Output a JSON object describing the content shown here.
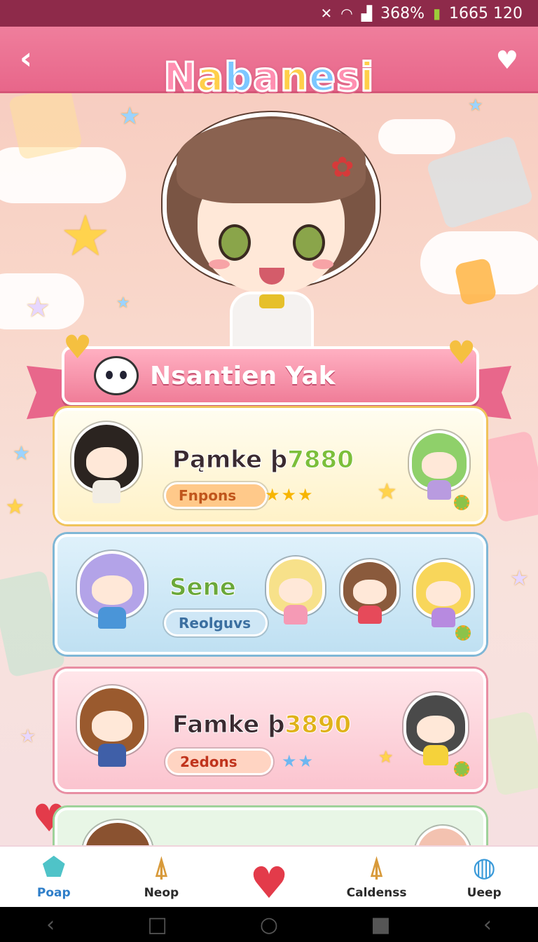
{
  "status_bar": {
    "battery_percent": "368%",
    "time": "1665 120"
  },
  "header": {
    "title": "Nabanesi",
    "back_icon": "chevron-left-icon",
    "favorite_icon": "heart-icon"
  },
  "banner": {
    "title": "Nsantien Yak"
  },
  "cards": [
    {
      "title_prefix": "Pąmke þ",
      "title_number": "7880",
      "pill": "Fnpons",
      "stars": "★★★"
    },
    {
      "title": "Sene",
      "pill": "Reolguvs"
    },
    {
      "title_prefix": "Famke þ",
      "title_number": "3890",
      "pill": "2edons",
      "stars": "★★"
    }
  ],
  "bottom_nav": [
    {
      "label": "Poap",
      "icon": "house-icon",
      "active": true
    },
    {
      "label": "Neop",
      "icon": "cone-icon",
      "active": false
    },
    {
      "label": "",
      "icon": "heart-icon",
      "active": false
    },
    {
      "label": "Caldenss",
      "icon": "cone-icon",
      "active": false
    },
    {
      "label": "Ueep",
      "icon": "globe-icon",
      "active": false
    }
  ],
  "colors": {
    "header_pink": "#e8668a",
    "status_bar": "#8e2a4a",
    "active_nav": "#2e7ec9"
  }
}
